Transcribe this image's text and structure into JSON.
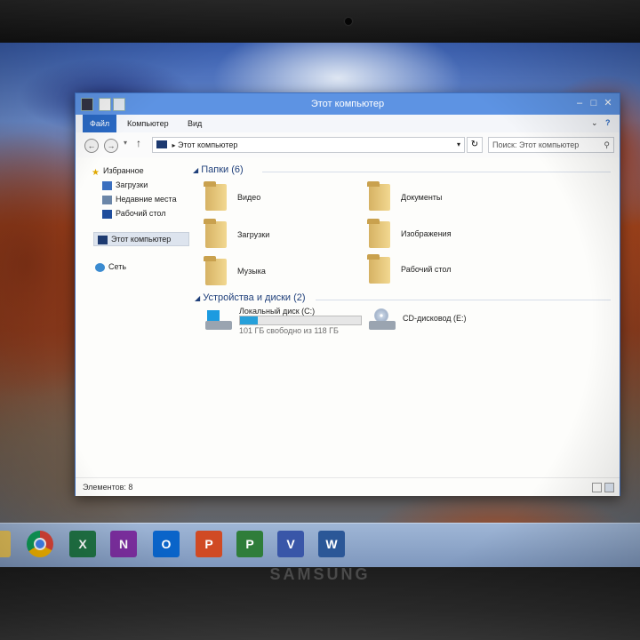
{
  "window": {
    "title": "Этот компьютер",
    "ribbon_tabs": [
      "Файл",
      "Компьютер",
      "Вид"
    ],
    "address": "Этот компьютер",
    "search_placeholder": "Поиск: Этот компьютер",
    "help": "?"
  },
  "nav": {
    "favorites": "Избранное",
    "downloads": "Загрузки",
    "recent": "Недавние места",
    "desktop": "Рабочий стол",
    "this_pc": "Этот компьютер",
    "network": "Сеть"
  },
  "groups": {
    "folders_header": "Папки (6)",
    "devices_header": "Устройства и диски (2)"
  },
  "folders": [
    "Видео",
    "Документы",
    "Загрузки",
    "Изображения",
    "Музыка",
    "Рабочий стол"
  ],
  "drives": {
    "c_name": "Локальный диск (C:)",
    "c_free": "101 ГБ свободно из 118 ГБ",
    "c_used_fraction": 0.144,
    "dvd_name": "CD-дисковод (E:)"
  },
  "status": {
    "items": "Элементов: 8"
  },
  "taskbar": {
    "apps": [
      "chrome-icon",
      "excel-icon",
      "onenote-icon",
      "outlook-icon",
      "powerpoint-icon",
      "project-icon",
      "visio-icon",
      "word-icon"
    ]
  },
  "monitor": {
    "brand": "SAMSUNG"
  },
  "colors": {
    "accent": "#2a69c4",
    "title_bar": "#5d93e3",
    "drive_bar": "#26a0da"
  }
}
